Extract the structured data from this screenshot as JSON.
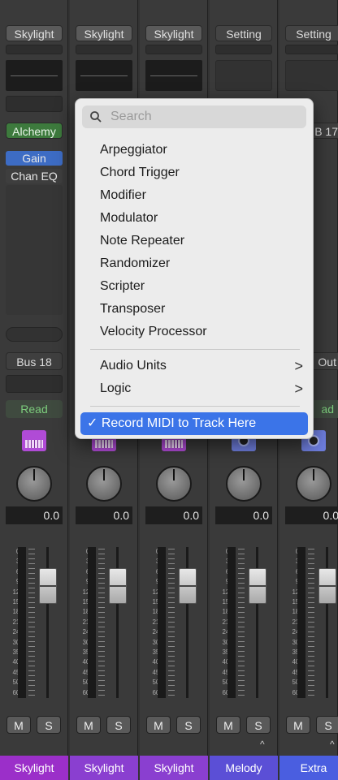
{
  "strips": [
    {
      "setting": "Skylight",
      "instrument": "Alchemy",
      "fx": [
        "Gain",
        "Chan EQ"
      ],
      "output": "Bus 18",
      "automation": "Read",
      "pan": "0.0",
      "name": "Skylight",
      "name_color": "#9b2fc9"
    },
    {
      "setting": "Skylight",
      "pan": "0.0",
      "name": "Skylight",
      "name_color": "#8a3fd0"
    },
    {
      "setting": "Skylight",
      "pan": "0.0",
      "name": "Skylight",
      "name_color": "#8a3fd0"
    },
    {
      "setting": "Setting",
      "pan": "0.0",
      "name": "Melody",
      "name_color": "#5b4fd6"
    },
    {
      "setting": "Setting",
      "instrument": "B 17",
      "output": "Out",
      "automation": "ad",
      "pan": "0.0",
      "name": "Extra",
      "name_color": "#4a5ee0"
    }
  ],
  "buttons": {
    "mute": "M",
    "solo": "S"
  },
  "scale_labels": [
    "0",
    "3",
    "6",
    "9",
    "12",
    "15",
    "18",
    "21",
    "24",
    "30",
    "35",
    "40",
    "45",
    "50",
    "60"
  ],
  "menu": {
    "search_placeholder": "Search",
    "items": [
      "Arpeggiator",
      "Chord Trigger",
      "Modifier",
      "Modulator",
      "Note Repeater",
      "Randomizer",
      "Scripter",
      "Transposer",
      "Velocity Processor"
    ],
    "submenus": [
      "Audio Units",
      "Logic"
    ],
    "submenu_chevron": ">",
    "checked_item": "✓ Record MIDI to Track Here"
  }
}
